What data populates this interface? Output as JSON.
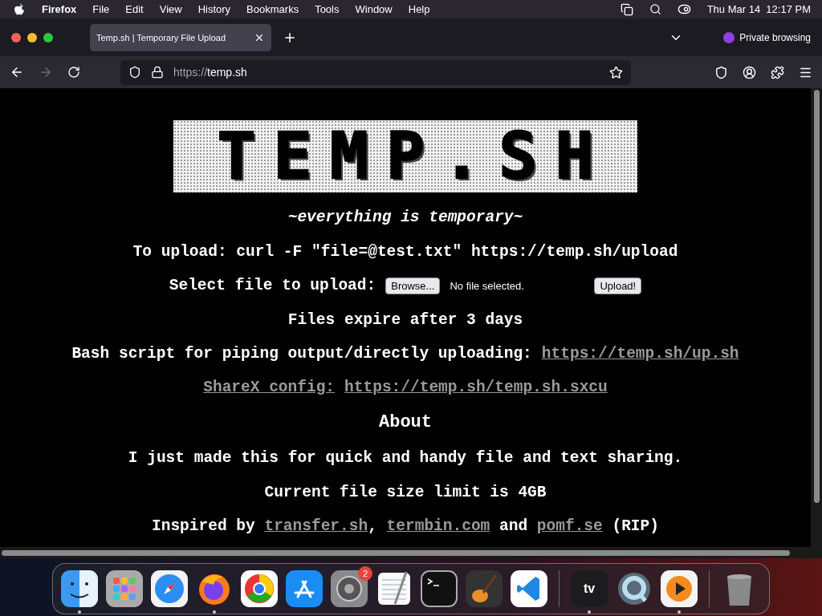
{
  "menubar": {
    "app": "Firefox",
    "menus": [
      "File",
      "Edit",
      "View",
      "History",
      "Bookmarks",
      "Tools",
      "Window",
      "Help"
    ],
    "clock": "Thu Mar 14  12:17 PM"
  },
  "browser": {
    "tab": {
      "title": "Temp.sh | Temporary File Upload",
      "selected": true
    },
    "private_label": "Private browsing",
    "url": {
      "scheme": "https://",
      "host": "temp.sh"
    }
  },
  "page": {
    "logo": "TEMP.SH",
    "tagline": "~everything is temporary~",
    "upload_command": "To upload: curl -F \"file=@test.txt\" https://temp.sh/upload",
    "file_picker": {
      "label": "Select file to upload:",
      "browse": "Browse...",
      "status": "No file selected.",
      "submit": "Upload!"
    },
    "expiry": "Files expire after 3 days",
    "bash": {
      "text": "Bash script for piping output/directly uploading:",
      "link": "https://temp.sh/up.sh"
    },
    "sharex": {
      "label": "ShareX config:",
      "link": "https://temp.sh/temp.sh.sxcu"
    },
    "about_heading": "About",
    "paragraphs": [
      "I just made this for quick and handy file and text sharing.",
      "Current file size limit is 4GB"
    ],
    "inspired": [
      {
        "text": "Inspired by",
        "link": false
      },
      {
        "text": "transfer.sh",
        "link": true
      },
      {
        "text": ",",
        "link": false
      },
      {
        "text": "termbin.com",
        "link": true
      },
      {
        "text": "and",
        "link": false
      },
      {
        "text": "pomf.se",
        "link": true
      },
      {
        "text": "(RIP)",
        "link": false
      }
    ]
  },
  "dock": [
    {
      "kind": "finder",
      "running": true
    },
    {
      "kind": "launchpad",
      "running": false
    },
    {
      "kind": "safari",
      "running": false
    },
    {
      "kind": "firefox",
      "running": true
    },
    {
      "kind": "chrome",
      "running": false
    },
    {
      "kind": "appstore",
      "running": false
    },
    {
      "kind": "settings",
      "running": false,
      "badge": "2"
    },
    {
      "kind": "textedit",
      "running": false
    },
    {
      "kind": "terminal",
      "running": false
    },
    {
      "kind": "garageband",
      "running": false
    },
    {
      "kind": "vscode",
      "running": false
    },
    {
      "kind": "divider"
    },
    {
      "kind": "tv",
      "running": true,
      "label": "tv"
    },
    {
      "kind": "quicktime",
      "running": false
    },
    {
      "kind": "infuse",
      "running": true
    },
    {
      "kind": "divider"
    },
    {
      "kind": "trash",
      "running": false
    }
  ]
}
